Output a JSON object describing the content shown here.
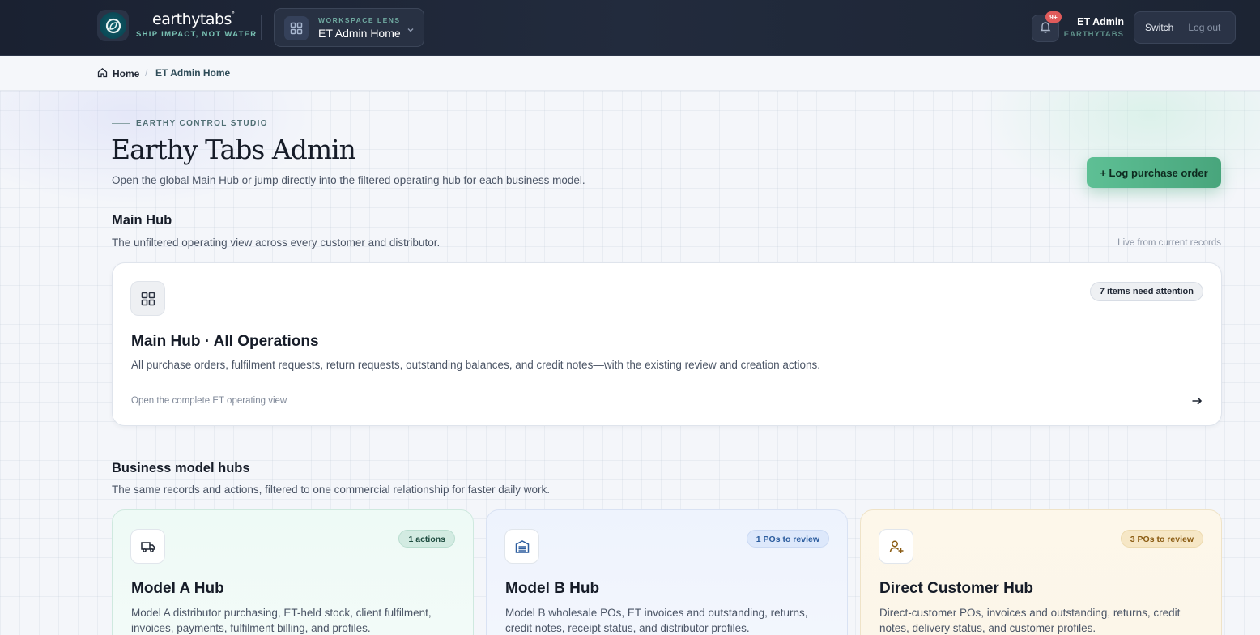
{
  "brand": {
    "name": "earthytabs",
    "trademark": "°",
    "tagline": "SHIP IMPACT, NOT WATER"
  },
  "lens": {
    "kicker": "WORKSPACE LENS",
    "value": "ET Admin Home"
  },
  "notifications": {
    "count": "9+"
  },
  "user": {
    "name": "ET Admin",
    "org": "EARTHYTABS",
    "switch_label": "Switch",
    "logout_label": "Log out"
  },
  "breadcrumb": {
    "home": "Home",
    "separator": "/",
    "current": "ET Admin Home"
  },
  "header": {
    "kicker": "EARTHY CONTROL STUDIO",
    "title": "Earthy Tabs Admin",
    "subtitle": "Open the global Main Hub or jump directly into the filtered operating hub for each business model.",
    "cta": "+ Log purchase order"
  },
  "main_hub": {
    "section_title": "Main Hub",
    "section_sub": "The unfiltered operating view across every customer and distributor.",
    "live_note": "Live from current records",
    "card": {
      "badge": "7 items need attention",
      "title": "Main Hub · All Operations",
      "description": "All purchase orders, fulfilment requests, return requests, outstanding balances, and credit notes—with the existing review and creation actions.",
      "footer": "Open the complete ET operating view"
    }
  },
  "business_hubs": {
    "section_title": "Business model hubs",
    "section_sub": "The same records and actions, filtered to one commercial relationship for faster daily work.",
    "cards": [
      {
        "badge": "1 actions",
        "title": "Model A Hub",
        "description": "Model A distributor purchasing, ET-held stock, client fulfilment, invoices, payments, fulfilment billing, and profiles.",
        "icon": "truck-icon"
      },
      {
        "badge": "1 POs to review",
        "title": "Model B Hub",
        "description": "Model B wholesale POs, ET invoices and outstanding, returns, credit notes, receipt status, and distributor profiles.",
        "icon": "warehouse-icon"
      },
      {
        "badge": "3 POs to review",
        "title": "Direct Customer Hub",
        "description": "Direct-customer POs, invoices and outstanding, returns, credit notes, delivery status, and customer profiles.",
        "icon": "user-plus-icon"
      }
    ]
  },
  "colors": {
    "topbar": "#1a2131",
    "accent_green": "#5ec095",
    "hub_a": "#eefaf6",
    "hub_b": "#eef3fd",
    "hub_c": "#fdf7ea"
  }
}
